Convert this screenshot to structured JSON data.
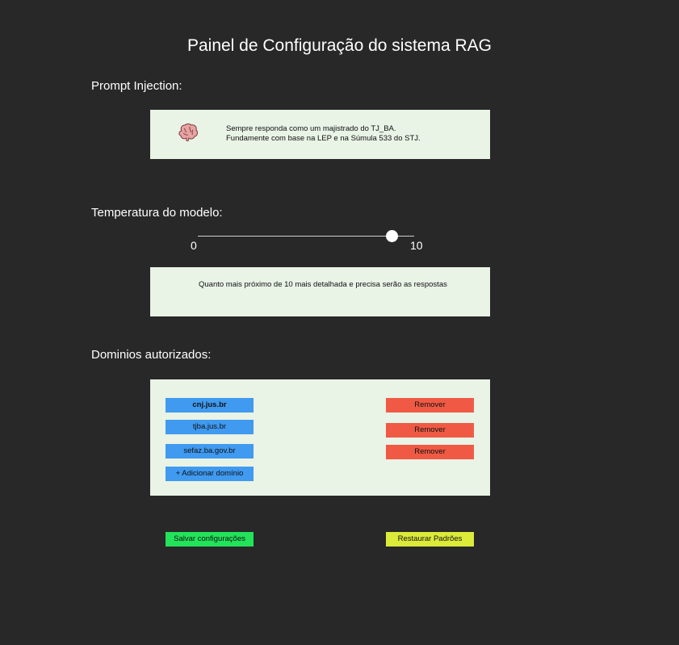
{
  "title": "Painel de Configuração do sistema RAG",
  "prompt": {
    "label": "Prompt Injection:",
    "icon": "brain-icon",
    "text": "Sempre responda como um majistrado do TJ_BA.\nFundamente com base na LEP e na Súmula 533 do STJ."
  },
  "temperature": {
    "label": "Temperatura do modelo:",
    "min_label": "0",
    "max_label": "10",
    "value": 9,
    "hint": "Quanto mais próximo de 10 mais detalhada e precisa serão as respostas"
  },
  "domains": {
    "label": "Dominios autorizados:",
    "items": [
      "cnj.jus.br",
      "tjba.jus.br",
      "sefaz.ba.gov.br"
    ],
    "remove_label": "Remover",
    "add_label": "+ Adicionar domínio"
  },
  "actions": {
    "save_label": "Salvar configurações",
    "restore_label": "Restaurar Padrões"
  },
  "colors": {
    "background": "#282828",
    "panel": "#e9f3e6",
    "domain_chip": "#3f9af0",
    "remove": "#f05a45",
    "save": "#22e35a",
    "restore": "#dcea3a"
  }
}
